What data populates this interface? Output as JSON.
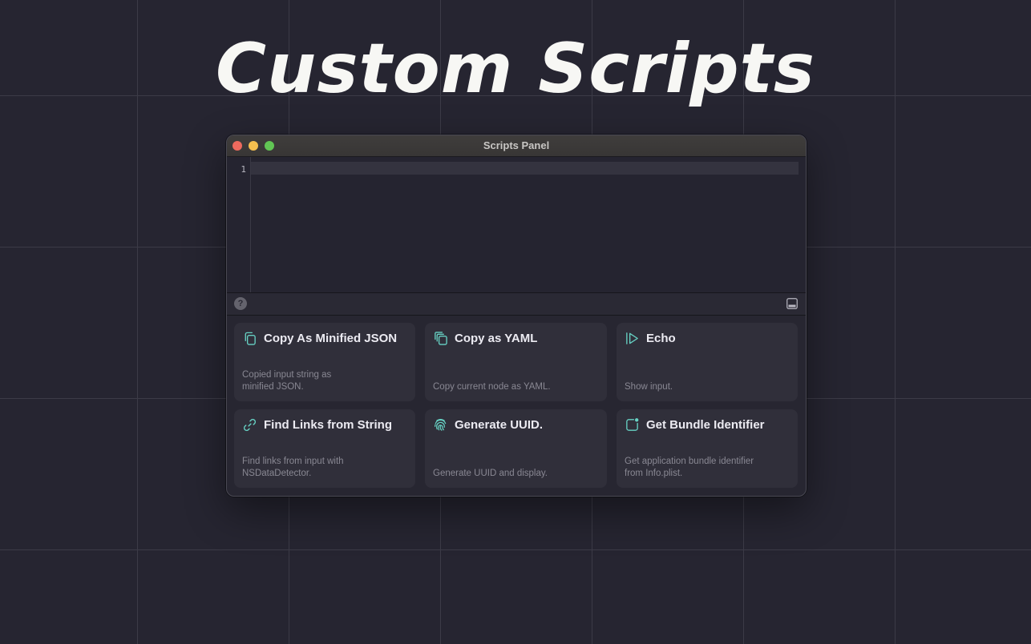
{
  "headline": "Custom Scripts",
  "window": {
    "title": "Scripts Panel",
    "editor": {
      "line_number": "1"
    },
    "toolbar": {
      "help_label": "?"
    }
  },
  "scripts": [
    {
      "title": "Copy As Minified JSON",
      "description": "Copied input string as\nminified JSON.",
      "icon": "copy-icon"
    },
    {
      "title": "Copy as YAML",
      "description": "Copy current node as YAML.",
      "icon": "copy-stack-icon"
    },
    {
      "title": "Echo",
      "description": "Show input.",
      "icon": "play-icon"
    },
    {
      "title": "Find Links from String",
      "description": "Find links from input with\nNSDataDetector.",
      "icon": "link-icon"
    },
    {
      "title": "Generate UUID.",
      "description": "Generate UUID and display.",
      "icon": "fingerprint-icon"
    },
    {
      "title": "Get Bundle Identifier",
      "description": "Get application bundle identifier\nfrom Info.plist.",
      "icon": "app-badge-icon"
    }
  ],
  "colors": {
    "accent": "#67d2c4",
    "background": "#262531",
    "close": "#ed6a5e",
    "minimize": "#f5bf4f",
    "maximize": "#61c554"
  }
}
